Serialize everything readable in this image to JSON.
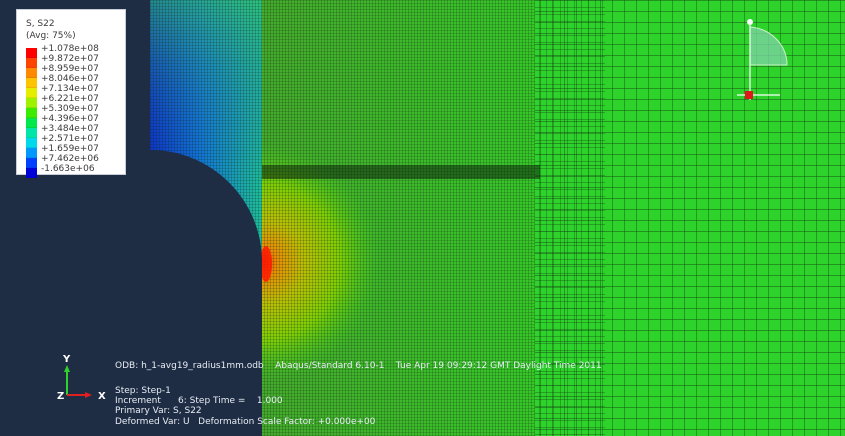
{
  "legend": {
    "title": "S, S22",
    "subtitle": "(Avg: 75%)",
    "entries": [
      {
        "label": "+1.078e+08",
        "color": "#ff0000"
      },
      {
        "label": "+9.872e+07",
        "color": "#ff4400"
      },
      {
        "label": "+8.959e+07",
        "color": "#ff8a00"
      },
      {
        "label": "+8.046e+07",
        "color": "#ffc400"
      },
      {
        "label": "+7.134e+07",
        "color": "#e6ee00"
      },
      {
        "label": "+6.221e+07",
        "color": "#9ef200"
      },
      {
        "label": "+5.309e+07",
        "color": "#3cec00"
      },
      {
        "label": "+4.396e+07",
        "color": "#00e84a"
      },
      {
        "label": "+3.484e+07",
        "color": "#00e6a8"
      },
      {
        "label": "+2.571e+07",
        "color": "#00d8ec"
      },
      {
        "label": "+1.659e+07",
        "color": "#0098ff"
      },
      {
        "label": "+7.462e+06",
        "color": "#0040ff"
      },
      {
        "label": "-1.663e+06",
        "color": "#0000d8"
      }
    ]
  },
  "triad": {
    "y_label": "Y",
    "x_label": "X",
    "z_label": "Z"
  },
  "info": {
    "odb_line": "ODB: h_1-avg19_radius1mm.odb    Abaqus/Standard 6.10-1    Tue Apr 19 09:29:12 GMT Daylight Time 2011",
    "step_line": "Step: Step-1",
    "increment_line": "Increment      6: Step Time =    1.000",
    "primary_var_line": "Primary Var: S, S22",
    "deformed_var_line": "Deformed Var: U   Deformation Scale Factor: +0.000e+00"
  },
  "colors": {
    "background": "#1f2d44",
    "field_green": "#2fd12a",
    "mesh_line": "#0a2a0a"
  }
}
